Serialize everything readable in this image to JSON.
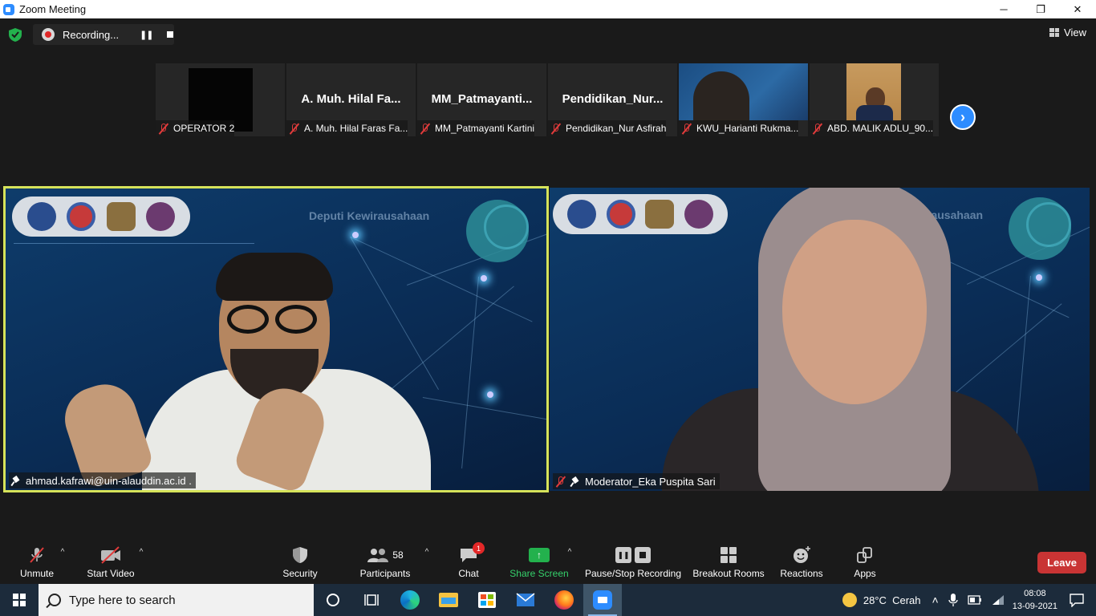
{
  "window": {
    "title": "Zoom Meeting",
    "minimize": "─",
    "restore": "❐",
    "close": "✕"
  },
  "recording": {
    "label": "Recording...",
    "pause_icon": "pause-icon",
    "stop_icon": "stop-icon"
  },
  "view_button": {
    "label": "View"
  },
  "thumbnails": [
    {
      "display": "",
      "label": "OPERATOR 2"
    },
    {
      "display": "A. Muh. Hilal Fa...",
      "label": "A. Muh. Hilal Faras Fa..."
    },
    {
      "display": "MM_Patmayanti...",
      "label": "MM_Patmayanti Kartini"
    },
    {
      "display": "Pendidikan_Nur...",
      "label": "Pendidikan_Nur Asfirah"
    },
    {
      "display": "",
      "label": "KWU_Harianti Rukma..."
    },
    {
      "display": "",
      "label": "ABD. MALIK ADLU_90..."
    }
  ],
  "videos": {
    "left": {
      "name": "ahmad.kafrawi@uin-alauddin.ac.id .",
      "banner": "Deputi Kewirausahaan"
    },
    "right": {
      "name": "Moderator_Eka Puspita Sari",
      "banner": "rausahaan"
    }
  },
  "toolbar": {
    "unmute": "Unmute",
    "start_video": "Start Video",
    "security": "Security",
    "participants": "Participants",
    "participants_count": "58",
    "chat": "Chat",
    "chat_badge": "1",
    "share_screen": "Share Screen",
    "pause_recording": "Pause/Stop Recording",
    "breakout_rooms": "Breakout Rooms",
    "reactions": "Reactions",
    "apps": "Apps",
    "leave": "Leave"
  },
  "taskbar": {
    "search_placeholder": "Type here to search",
    "weather": "28°C  Cerah",
    "time": "08:08",
    "date": "13-09-2021"
  },
  "colors": {
    "accent": "#2d8cff",
    "active_speaker_border": "#d6e35a",
    "leave": "#c93434",
    "share": "#23b14d",
    "mute": "#e03b3b"
  }
}
